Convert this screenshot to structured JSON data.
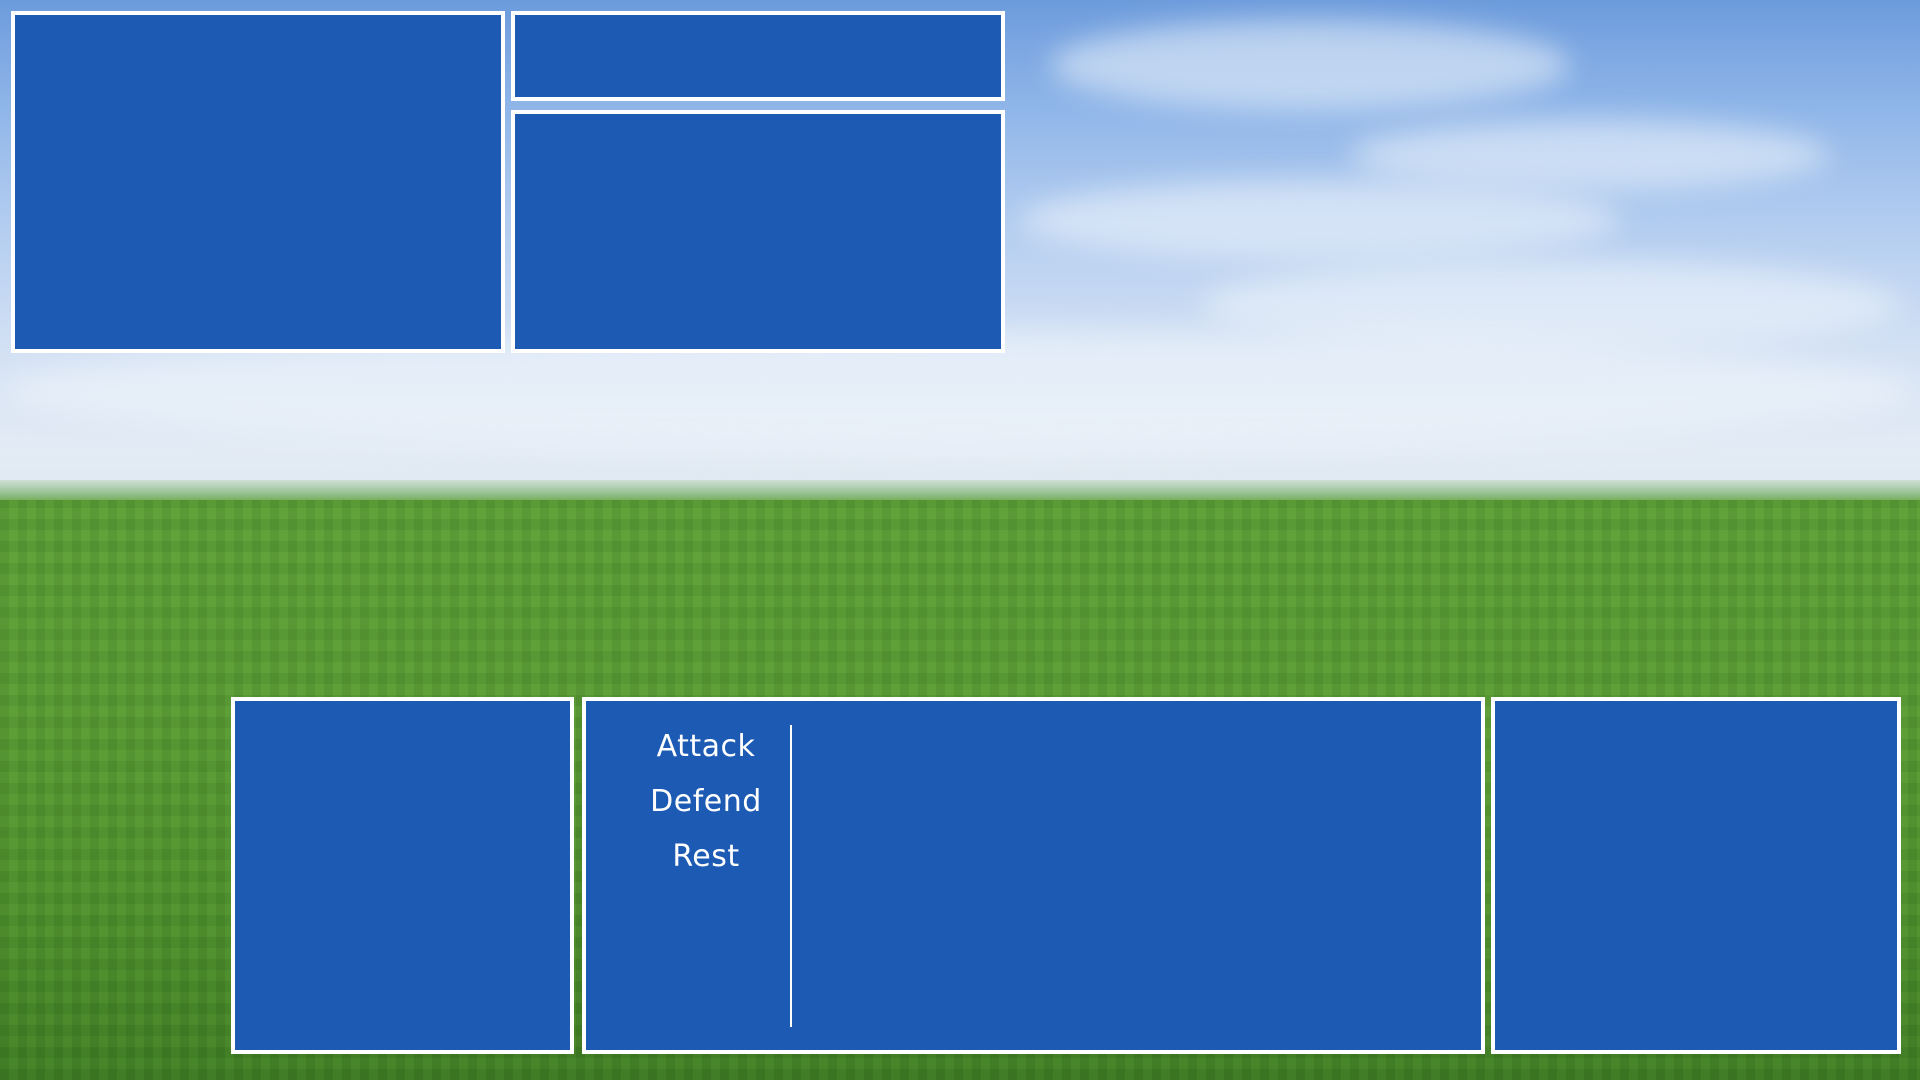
{
  "scene": {
    "background": "sky-and-grass-field",
    "colors": {
      "panel_fill": "#1c5ab3",
      "panel_border": "#ffffff",
      "sky_top": "#6c9bdc",
      "grass": "#5a9a35"
    }
  },
  "battle_menu": {
    "commands": [
      {
        "label": "Attack"
      },
      {
        "label": "Defend"
      },
      {
        "label": "Rest"
      }
    ]
  }
}
